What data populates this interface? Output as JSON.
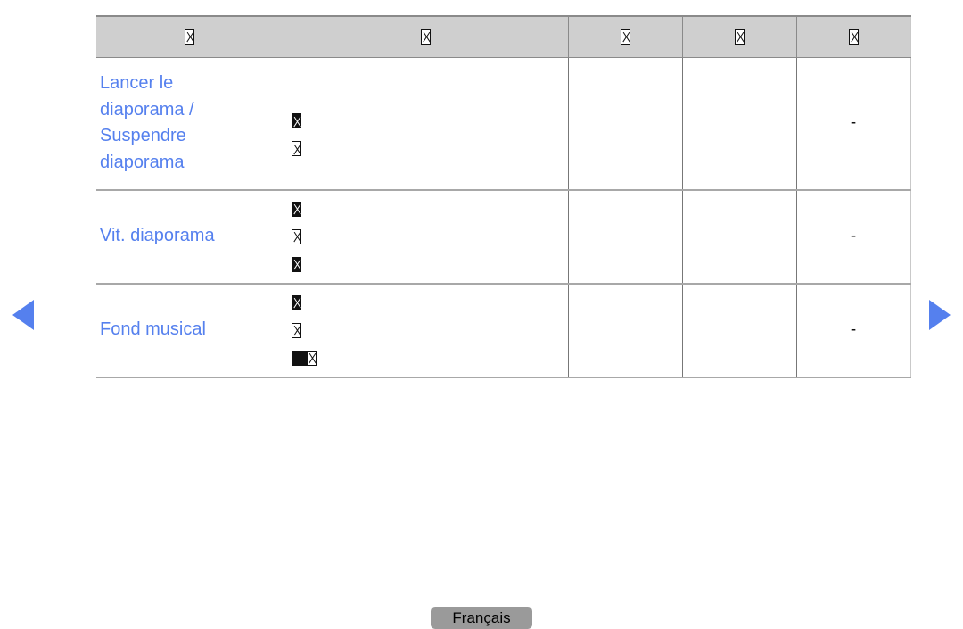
{
  "page": {
    "language_button": "Français"
  },
  "nav": {
    "prev_label": "previous-page",
    "next_label": "next-page"
  },
  "table": {
    "headers": [
      {
        "glyph": "tofu",
        "text": ""
      },
      {
        "glyph": "tofu",
        "text": ""
      },
      {
        "glyph": "tofu",
        "text": ""
      },
      {
        "glyph": "tofu",
        "text": ""
      },
      {
        "glyph": "tofu",
        "text": ""
      }
    ],
    "rows": [
      {
        "label": "Lancer le diaporama / Suspendre diaporama",
        "label_lines": [
          "Lancer le",
          "diaporama /",
          "Suspendre",
          "diaporama"
        ],
        "options": [
          {
            "glyph": "tofu-inverted"
          },
          {
            "glyph": "tofu"
          }
        ],
        "col3": "",
        "col4": "",
        "col5": "-"
      },
      {
        "label": "Vit. diaporama",
        "label_lines": [
          "Vit. diaporama"
        ],
        "options": [
          {
            "glyph": "tofu-inverted"
          },
          {
            "glyph": "tofu"
          },
          {
            "glyph": "tofu-inverted"
          }
        ],
        "col3": "",
        "col4": "",
        "col5": "-"
      },
      {
        "label": "Fond musical",
        "label_lines": [
          "Fond musical"
        ],
        "options": [
          {
            "glyph": "tofu-inverted"
          },
          {
            "glyph": "tofu"
          },
          {
            "glyph": "blackbox-tofu"
          }
        ],
        "col3": "",
        "col4": "",
        "col5": "-"
      }
    ]
  },
  "colors": {
    "label_blue": "#5580ee",
    "header_gray": "#cfcfcf",
    "button_gray": "#9a9a9a",
    "border_gray": "#a8a8a8"
  }
}
